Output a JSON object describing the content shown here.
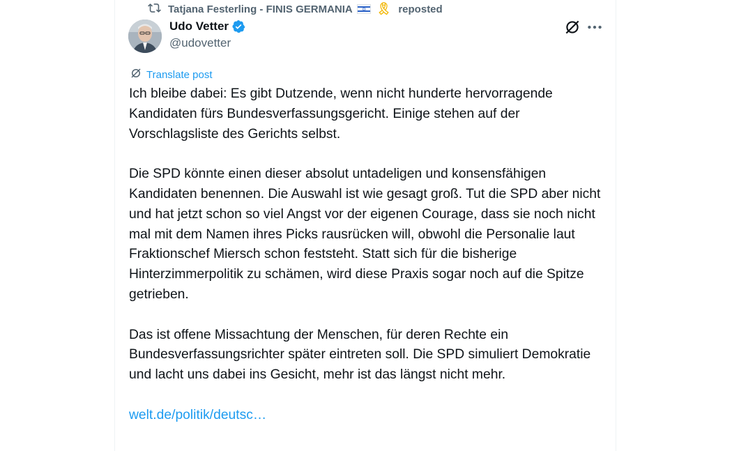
{
  "repost": {
    "user": "Tatjana Festerling - FINIS GERMANIA",
    "action": "reposted"
  },
  "author": {
    "display_name": "Udo Vetter",
    "handle": "@udovetter"
  },
  "translate_label": "Translate post",
  "post": {
    "paragraphs": [
      "Ich bleibe dabei: Es gibt Dutzende, wenn nicht hunderte hervorragende Kandidaten fürs Bundesverfassungsgericht. Einige stehen auf der Vorschlagsliste des Gerichts selbst.",
      "Die SPD könnte einen dieser absolut untadeligen und konsensfähigen Kandidaten benennen. Die Auswahl ist wie gesagt groß. Tut die SPD aber nicht und hat jetzt schon so viel Angst vor der eigenen Courage, dass sie noch nicht mal mit dem Namen ihres Picks rausrücken will, obwohl die Personalie laut Fraktionschef Miersch schon feststeht. Statt sich für die bisherige Hinterzimmerpolitik zu schämen, wird diese Praxis sogar noch auf die Spitze getrieben.",
      "Das ist offene Missachtung der Menschen, für deren Rechte ein Bundesverfassungsrichter später eintreten soll. Die SPD simuliert Demokratie und lacht uns dabei ins Gesicht, mehr ist das längst nicht mehr."
    ],
    "link": "welt.de/politik/deutsc…"
  },
  "icons": {
    "repost": "repost-icon",
    "verified": "verified-badge-icon",
    "grok": "grok-icon",
    "more": "more-dots-icon",
    "translate": "translate-icon",
    "flag": "israel-flag-icon",
    "ribbon": "yellow-ribbon-icon"
  },
  "colors": {
    "accent": "#1d9bf0",
    "text": "#0f1419",
    "secondary": "#536471"
  }
}
